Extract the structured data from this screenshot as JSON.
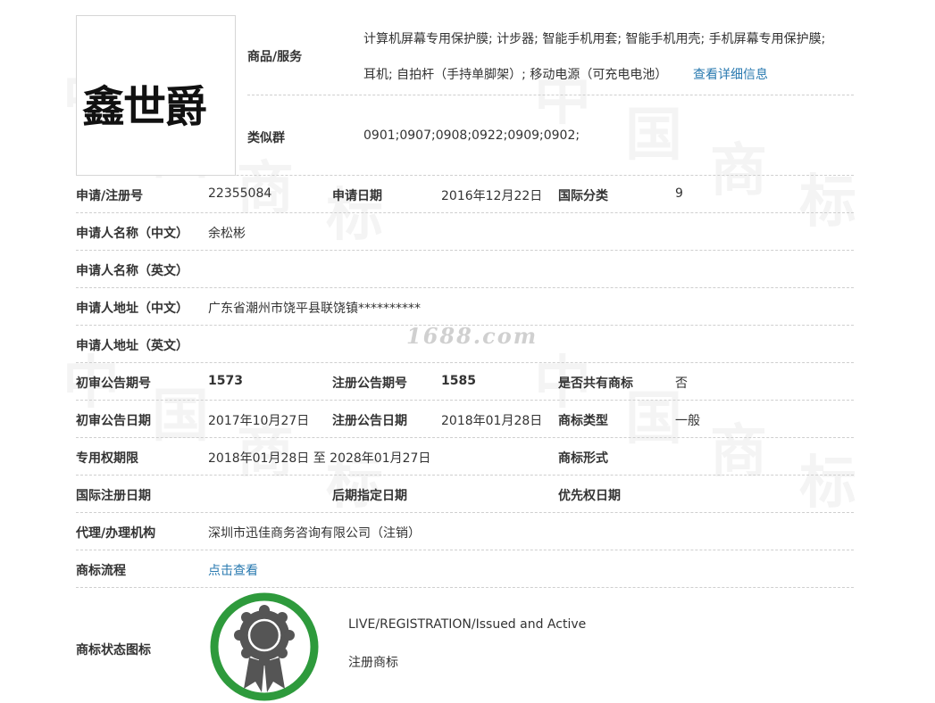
{
  "watermark": {
    "site": "1688.com",
    "chars": [
      "中",
      "国",
      "商",
      "标"
    ]
  },
  "logo": {
    "text": "鑫世爵"
  },
  "goods": {
    "label": "商品/服务",
    "line1": "计算机屏幕专用保护膜; 计步器; 智能手机用套; 智能手机用壳; 手机屏幕专用保护膜;",
    "line2": "耳机; 自拍杆（手持单脚架）; 移动电源（可充电电池）",
    "detail_link": "查看详细信息"
  },
  "similar": {
    "label": "类似群",
    "value": "0901;0907;0908;0922;0909;0902;"
  },
  "rows": {
    "reg_no": {
      "label": "申请/注册号",
      "value": "22355084"
    },
    "apply_date": {
      "label": "申请日期",
      "value": "2016年12月22日"
    },
    "intl_class": {
      "label": "国际分类",
      "value": "9"
    },
    "applicant_cn": {
      "label": "申请人名称（中文）",
      "value": "余松彬"
    },
    "applicant_en": {
      "label": "申请人名称（英文）",
      "value": ""
    },
    "address_cn": {
      "label": "申请人地址（中文）",
      "value": "广东省潮州市饶平县联饶镇**********"
    },
    "address_en": {
      "label": "申请人地址（英文）",
      "value": ""
    },
    "prelim_no": {
      "label": "初审公告期号",
      "value": "1573"
    },
    "reg_notice_no": {
      "label": "注册公告期号",
      "value": "1585"
    },
    "shared": {
      "label": "是否共有商标",
      "value": "否"
    },
    "prelim_date": {
      "label": "初审公告日期",
      "value": "2017年10月27日"
    },
    "reg_notice_date": {
      "label": "注册公告日期",
      "value": "2018年01月28日"
    },
    "tm_type": {
      "label": "商标类型",
      "value": "一般"
    },
    "exclusive_period": {
      "label": "专用权期限",
      "value": "2018年01月28日 至 2028年01月27日"
    },
    "tm_form": {
      "label": "商标形式",
      "value": ""
    },
    "intl_reg_date": {
      "label": "国际注册日期",
      "value": ""
    },
    "later_date": {
      "label": "后期指定日期",
      "value": ""
    },
    "priority_date": {
      "label": "优先权日期",
      "value": ""
    },
    "agent": {
      "label": "代理/办理机构",
      "value": "深圳市迅佳商务咨询有限公司（注销）"
    },
    "process": {
      "label": "商标流程",
      "link": "点击查看"
    },
    "status": {
      "label": "商标状态图标",
      "line1": "LIVE/REGISTRATION/Issued and Active",
      "line2": "注册商标"
    }
  },
  "colors": {
    "link": "#2a7ab0",
    "status_ring": "#2e9a3c",
    "status_icon": "#555555"
  }
}
